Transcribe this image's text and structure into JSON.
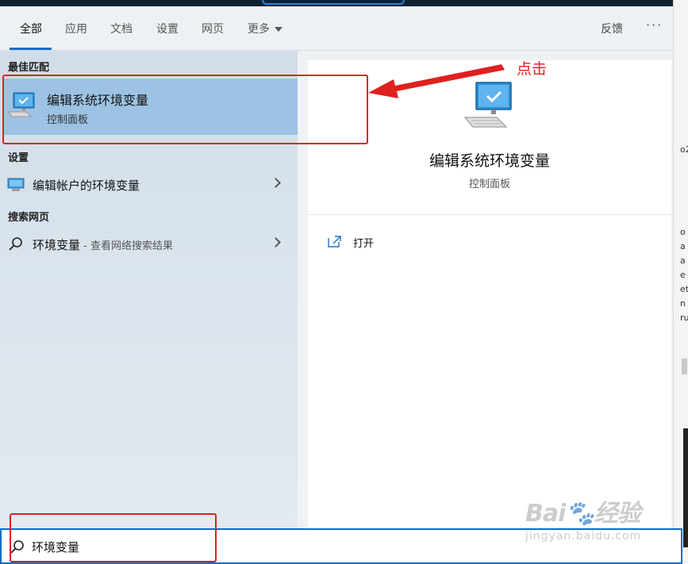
{
  "tabs": [
    {
      "label": "全部"
    },
    {
      "label": "应用"
    },
    {
      "label": "文档"
    },
    {
      "label": "设置"
    },
    {
      "label": "网页"
    },
    {
      "label": "更多"
    }
  ],
  "header": {
    "feedback_label": "反馈",
    "more_label": "···"
  },
  "left": {
    "best_match_heading": "最佳匹配",
    "best_match": {
      "title": "编辑系统环境变量",
      "subtitle": "控制面板"
    },
    "settings_heading": "设置",
    "settings_item": {
      "title": "编辑帐户的环境变量"
    },
    "web_heading": "搜索网页",
    "web_item": {
      "title": "环境变量",
      "hint": " - 查看网络搜索结果"
    }
  },
  "detail": {
    "title": "编辑系统环境变量",
    "subtitle": "控制面板",
    "actions": [
      {
        "label": "打开"
      }
    ]
  },
  "search": {
    "value": "环境变量"
  },
  "annotation": {
    "callout": "点击",
    "color": "#e02020"
  },
  "background_fragments": [
    "o2",
    "o",
    "a",
    "a",
    "e",
    "et",
    "n",
    "ru"
  ],
  "watermark": {
    "logo": "Bai🐾经验",
    "url": "jingyan.baidu.com"
  },
  "colors": {
    "accent": "#0e6cc4",
    "selected": "#9dc3e4"
  }
}
